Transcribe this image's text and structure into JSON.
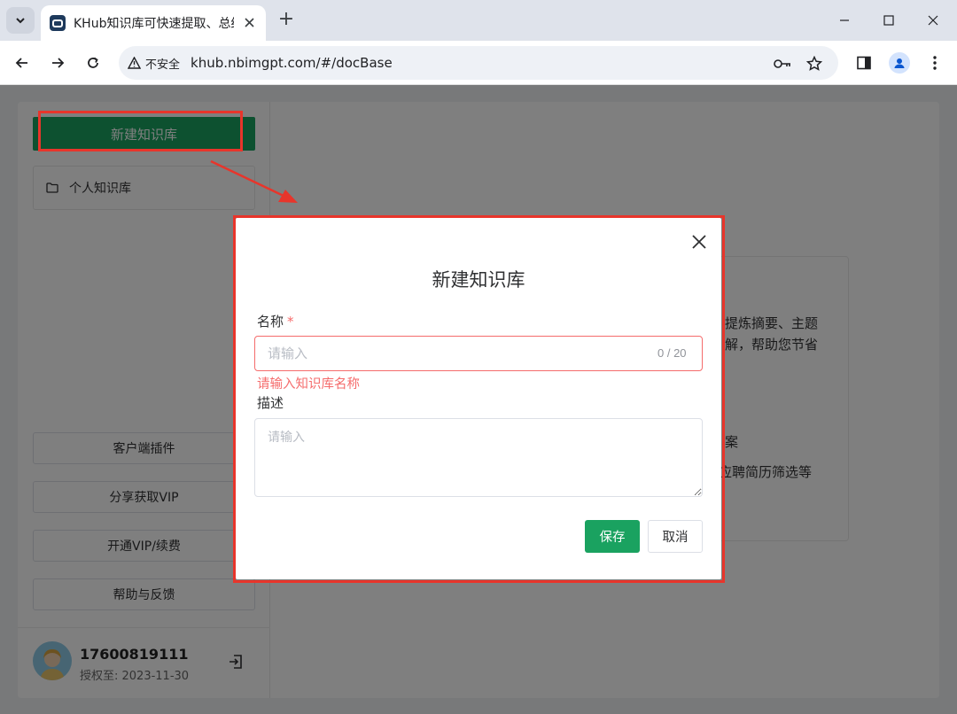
{
  "browser": {
    "tab_title": "KHub知识库可快速提取、总结",
    "new_tab_symbol": "+",
    "security_label": "不安全",
    "url": "khub.nbimgpt.com/#/docBase"
  },
  "sidebar": {
    "new_kb_label": "新建知识库",
    "kb_items": [
      {
        "label": "个人知识库"
      }
    ],
    "buttons": [
      {
        "label": "客户端插件"
      },
      {
        "label": "分享获取VIP"
      },
      {
        "label": "开通VIP/续费"
      },
      {
        "label": "帮助与反馈"
      }
    ],
    "user": {
      "name": "17600819111",
      "expire": "授权至: 2023-11-30"
    }
  },
  "background_text": {
    "line1": "提炼摘要、主题",
    "line2": "解，帮助您节省",
    "line3": "案",
    "line4": "应聘简历筛选等"
  },
  "modal": {
    "title": "新建知识库",
    "name_label": "名称",
    "required_mark": "*",
    "name_placeholder": "请输入",
    "name_counter": "0 / 20",
    "name_error": "请输入知识库名称",
    "desc_label": "描述",
    "desc_placeholder": "请输入",
    "save_label": "保存",
    "cancel_label": "取消"
  },
  "colors": {
    "brand_green": "#1aa260",
    "error_red": "#f56c6c",
    "annotation_red": "#e8352b"
  }
}
